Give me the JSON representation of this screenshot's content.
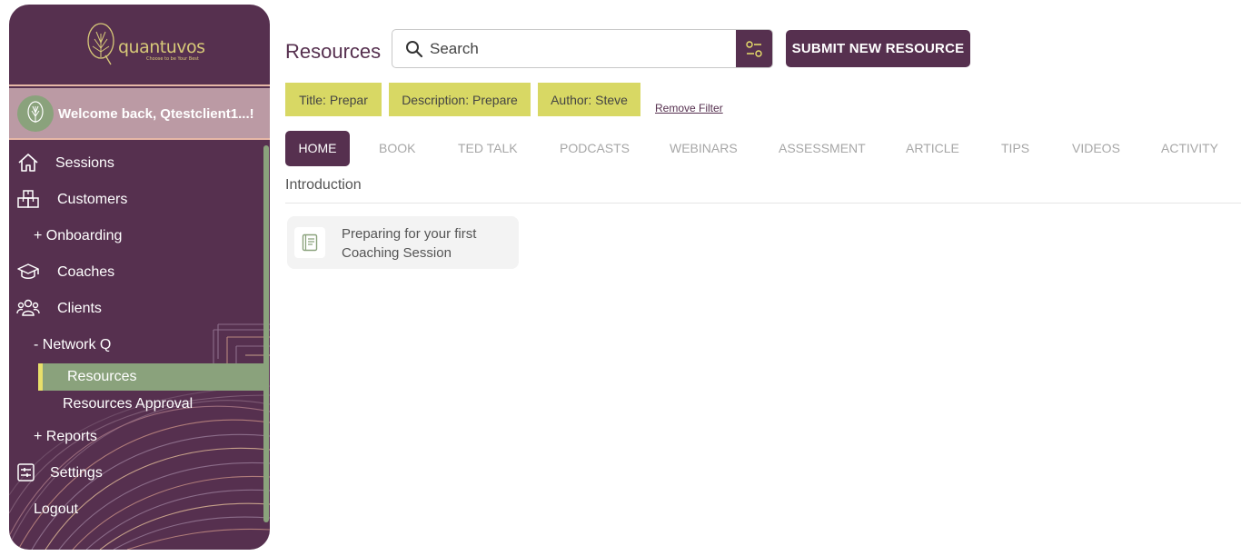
{
  "brand": {
    "name": "quantuvos",
    "tagline": "Choose to be Your Best"
  },
  "welcome": {
    "text": "Welcome back, Qtestclient1...!"
  },
  "sidebar": {
    "items": [
      {
        "label": "Sessions",
        "icon": "home-icon"
      },
      {
        "label": "Customers",
        "icon": "boxes-icon"
      },
      {
        "label": "+ Onboarding"
      },
      {
        "label": "Coaches",
        "icon": "graduation-cap-icon"
      },
      {
        "label": "Clients",
        "icon": "users-icon"
      },
      {
        "label": "- Network Q"
      },
      {
        "label": "Resources",
        "active": true
      },
      {
        "label": "Resources Approval"
      },
      {
        "label": "+ Reports"
      },
      {
        "label": "Settings",
        "icon": "settings-panel-icon"
      },
      {
        "label": "Logout"
      }
    ]
  },
  "header": {
    "title": "Resources",
    "search_placeholder": "Search",
    "submit_label": "SUBMIT NEW RESOURCE"
  },
  "filters": {
    "chips": [
      "Title: Prepar",
      "Description: Prepare",
      "Author: Steve"
    ],
    "remove_label": "Remove Filter"
  },
  "tabs": [
    "HOME",
    "BOOK",
    "TED TALK",
    "PODCASTS",
    "WEBINARS",
    "ASSESSMENT",
    "ARTICLE",
    "TIPS",
    "VIDEOS",
    "ACTIVITY"
  ],
  "active_tab": "HOME",
  "section": {
    "title": "Introduction"
  },
  "resources": [
    {
      "title": "Preparing for your first Coaching Session",
      "icon": "book-icon"
    }
  ],
  "colors": {
    "brand_purple": "#56304f",
    "sage_green": "#8aa27c",
    "chip_yellow": "#d8d864",
    "gold": "#d7c878"
  }
}
